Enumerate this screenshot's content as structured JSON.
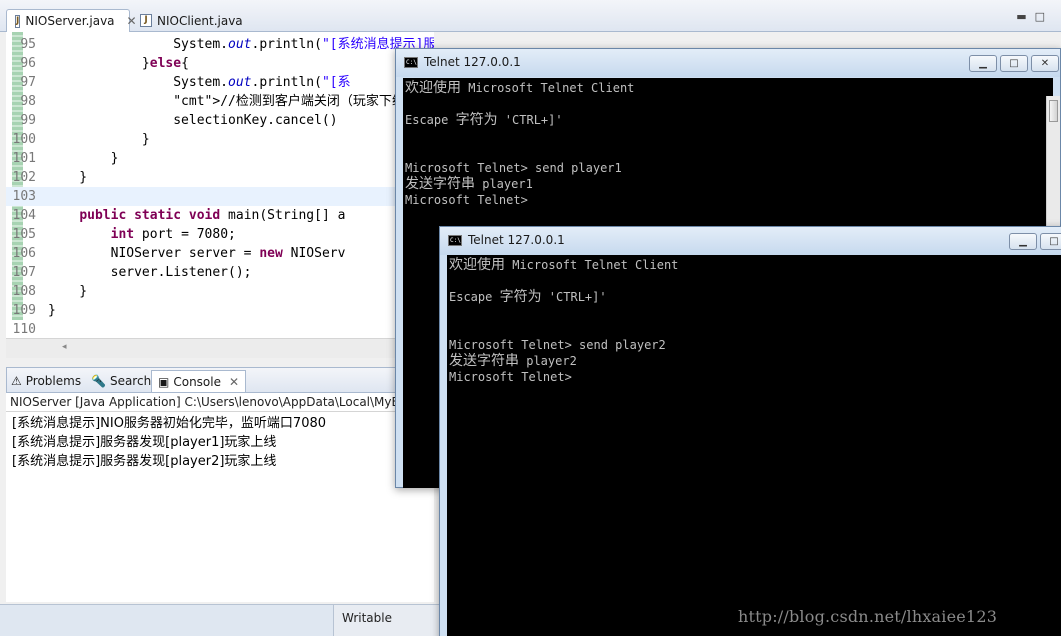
{
  "editor": {
    "tabs": [
      {
        "label": "NIOServer.java",
        "icon": "java-file-icon"
      },
      {
        "label": "NIOClient.java",
        "icon": "java-file-icon"
      }
    ],
    "lines": [
      {
        "num": "95",
        "code": "                System.out.println(\"[系统消息提示]服务器发现[\"+receiveText+\"]玩家上线\");"
      },
      {
        "num": "96",
        "code": "            }else{"
      },
      {
        "num": "97",
        "code": "                System.out.println(\"[系"
      },
      {
        "num": "98",
        "code": "                //检测到客户端关闭（玩家下线）,"
      },
      {
        "num": "99",
        "code": "                selectionKey.cancel()"
      },
      {
        "num": "100",
        "code": "            }"
      },
      {
        "num": "101",
        "code": "        }"
      },
      {
        "num": "102",
        "code": "    }"
      },
      {
        "num": "103",
        "code": ""
      },
      {
        "num": "104",
        "code": "    public static void main(String[] a"
      },
      {
        "num": "105",
        "code": "        int port = 7080;"
      },
      {
        "num": "106",
        "code": "        NIOServer server = new NIOServ"
      },
      {
        "num": "107",
        "code": "        server.Listener();"
      },
      {
        "num": "108",
        "code": "    }"
      },
      {
        "num": "109",
        "code": "}"
      },
      {
        "num": "110",
        "code": ""
      }
    ]
  },
  "console": {
    "tabs": [
      {
        "label": "Problems",
        "icon": "problems-icon"
      },
      {
        "label": "Search",
        "icon": "search-icon"
      },
      {
        "label": "Console",
        "icon": "console-icon"
      }
    ],
    "header": "NIOServer [Java Application] C:\\Users\\lenovo\\AppData\\Local\\MyE",
    "lines": [
      "[系统消息提示]NIO服务器初始化完毕，监听端口7080",
      "[系统消息提示]服务器发现[player1]玩家上线",
      "[系统消息提示]服务器发现[player2]玩家上线"
    ]
  },
  "statusbar": {
    "writable": "Writable"
  },
  "telnet1": {
    "title": "Telnet 127.0.0.1",
    "lines": [
      {
        "zh": "欢迎使用",
        "en": " Microsoft Telnet Client"
      },
      {
        "zh": "",
        "en": ""
      },
      {
        "zh": "",
        "en": "Escape "
      },
      {
        "zh": "",
        "en": ""
      },
      {
        "zh": "",
        "en": ""
      },
      {
        "zh": "",
        "en": "Microsoft Telnet> send player1"
      },
      {
        "zh": "发送字符串",
        "en": " player1"
      },
      {
        "zh": "",
        "en": "Microsoft Telnet>"
      }
    ],
    "escape_zh": "字符为",
    "escape_key": " 'CTRL+]'"
  },
  "telnet2": {
    "title": "Telnet 127.0.0.1",
    "lines": [
      {
        "zh": "欢迎使用",
        "en": " Microsoft Telnet Client"
      },
      {
        "zh": "",
        "en": ""
      },
      {
        "zh": "",
        "en": "Escape "
      },
      {
        "zh": "",
        "en": ""
      },
      {
        "zh": "",
        "en": ""
      },
      {
        "zh": "",
        "en": "Microsoft Telnet> send player2"
      },
      {
        "zh": "发送字符串",
        "en": " player2"
      },
      {
        "zh": "",
        "en": "Microsoft Telnet>"
      }
    ],
    "escape_zh": "字符为",
    "escape_key": " 'CTRL+]'"
  },
  "watermark": "http://blog.csdn.net/lhxaiee123"
}
